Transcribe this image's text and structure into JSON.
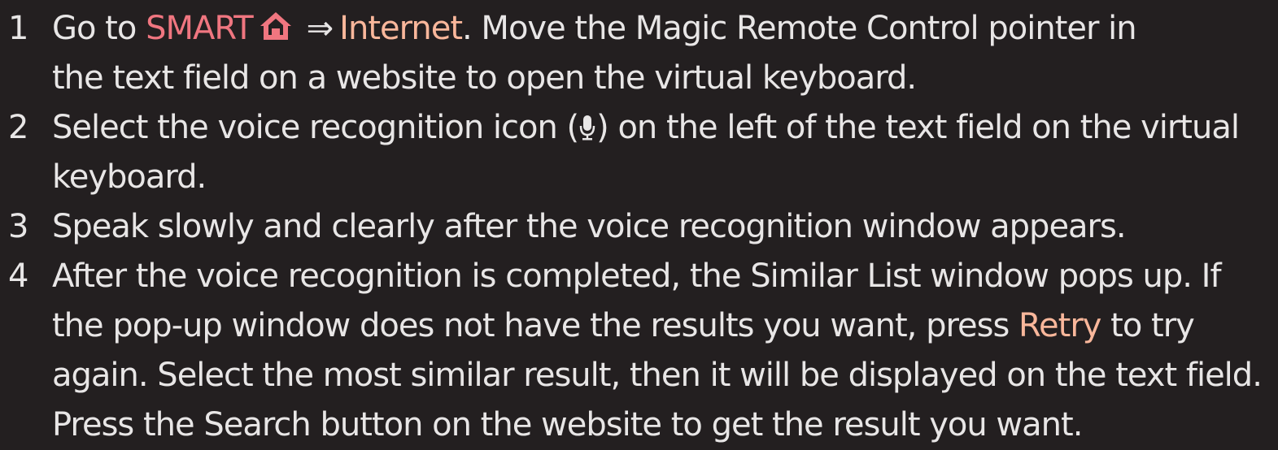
{
  "colors": {
    "background": "#231f20",
    "text": "#e8e6e6",
    "highlight_red": "#f07680",
    "highlight_orange": "#f9b79b"
  },
  "steps": [
    {
      "number": "1",
      "line1_prefix": "Go to ",
      "smart_label": "SMART",
      "smart_icon": "home-icon",
      "arrow": "⇒",
      "internet_label": "Internet",
      "line1_suffix": ". Move the Magic Remote Control pointer in",
      "line2": "the text field on a website to open the virtual keyboard."
    },
    {
      "number": "2",
      "line1_prefix": "Select the voice recognition icon (",
      "mic_icon": "microphone-icon",
      "line1_suffix": ") on the left of the text field on the virtual",
      "line2": "keyboard."
    },
    {
      "number": "3",
      "line1": "Speak slowly and clearly after the voice recognition window appears."
    },
    {
      "number": "4",
      "line1": "After the voice recognition is completed, the Similar List window pops up. If",
      "line2_prefix": "the pop-up window does not have the results you want, press ",
      "retry_label": "Retry",
      "line2_suffix": " to try",
      "line3": "again. Select the most similar result, then it will be displayed on the text field.",
      "line4": "Press the Search button on the website to get the result you want."
    }
  ]
}
